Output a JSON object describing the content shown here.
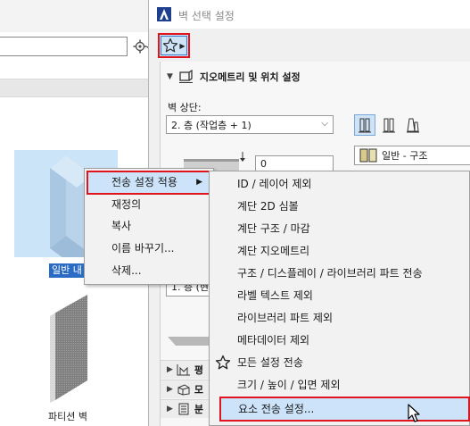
{
  "dialog": {
    "title": "벽 선택 설정",
    "section_title": "지오메트리 및 위치 설정",
    "top_link_label": "벽 상단:",
    "top_link_value": "2. 층 (작업층 + 1)",
    "structure_value": "일반 - 구조",
    "value_field": "0",
    "story_select_partial": "1. 층 (현",
    "sub_rows": [
      "평",
      "모",
      "분"
    ]
  },
  "left_panel": {
    "favorite_1_caption": "일반 내",
    "favorite_2_caption": "파티션 벽"
  },
  "context_menu": {
    "items": [
      {
        "label": "전송 설정 적용",
        "arrow": "▶"
      },
      {
        "label": "재정의"
      },
      {
        "label": "복사"
      },
      {
        "label": "이름 바꾸기..."
      },
      {
        "label": "삭제..."
      }
    ]
  },
  "submenu": {
    "items": [
      {
        "label": "ID / 레이어 제외"
      },
      {
        "label": "계단 2D 심볼"
      },
      {
        "label": "계단 구조 / 마감"
      },
      {
        "label": "계단 지오메트리"
      },
      {
        "label": "구조 / 디스플레이 / 라이브러리 파트 전송"
      },
      {
        "label": "라벨 텍스트 제외"
      },
      {
        "label": "라이브러리 파트 제외"
      },
      {
        "label": "메타데이터 제외"
      },
      {
        "label": "모든 설정 전송"
      },
      {
        "label": "크기 / 높이 / 입면 제외"
      },
      {
        "label": "요소 전송 설정..."
      }
    ]
  },
  "colors": {
    "highlight_border": "#e0141c",
    "selection_fill": "#cde3fa",
    "caption_selected": "#2a6cc4"
  }
}
